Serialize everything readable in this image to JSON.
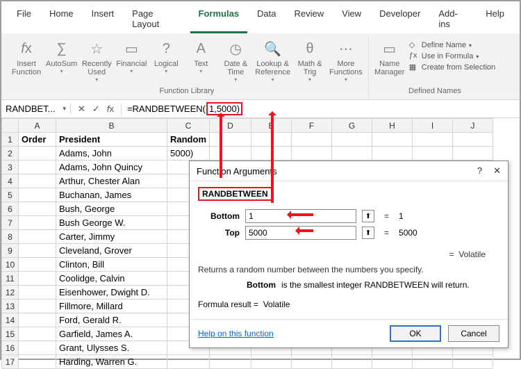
{
  "tabs": [
    "File",
    "Home",
    "Insert",
    "Page Layout",
    "Formulas",
    "Data",
    "Review",
    "View",
    "Developer",
    "Add-ins",
    "Help"
  ],
  "active_tab": "Formulas",
  "ribbon": {
    "group1": {
      "insert_function": "Insert\nFunction",
      "autosum": "AutoSum",
      "recently": "Recently\nUsed",
      "financial": "Financial",
      "logical": "Logical",
      "text": "Text",
      "date": "Date &\nTime",
      "lookup": "Lookup &\nReference",
      "math": "Math &\nTrig",
      "more": "More\nFunctions",
      "label": "Function Library"
    },
    "group2": {
      "name_manager": "Name\nManager",
      "define_name": "Define Name",
      "use_in_formula": "Use in Formula",
      "create_from_selection": "Create from Selection",
      "label": "Defined Names"
    }
  },
  "namebox": "RANDBET...",
  "formula": {
    "prefix": "=RANDBETWEEN(",
    "args": "1,5000)"
  },
  "columns": [
    "A",
    "B",
    "C",
    "D",
    "E",
    "F",
    "G",
    "H",
    "I",
    "J"
  ],
  "headers": {
    "A": "Order",
    "B": "President",
    "C": "Random"
  },
  "rows": [
    {
      "n": 1
    },
    {
      "n": 2,
      "B": "Adams, John",
      "C": "5000)"
    },
    {
      "n": 3,
      "B": "Adams, John Quincy"
    },
    {
      "n": 4,
      "B": "Arthur, Chester Alan"
    },
    {
      "n": 5,
      "B": "Buchanan, James"
    },
    {
      "n": 6,
      "B": "Bush, George"
    },
    {
      "n": 7,
      "B": "Bush George W."
    },
    {
      "n": 8,
      "B": "Carter, Jimmy"
    },
    {
      "n": 9,
      "B": "Cleveland, Grover"
    },
    {
      "n": 10,
      "B": "Clinton, Bill"
    },
    {
      "n": 11,
      "B": "Coolidge, Calvin"
    },
    {
      "n": 12,
      "B": "Eisenhower, Dwight D."
    },
    {
      "n": 13,
      "B": "Fillmore, Millard"
    },
    {
      "n": 14,
      "B": "Ford, Gerald R."
    },
    {
      "n": 15,
      "B": "Garfield, James A."
    },
    {
      "n": 16,
      "B": "Grant, Ulysses S."
    },
    {
      "n": 17,
      "B": "Harding, Warren G."
    }
  ],
  "dialog": {
    "title": "Function Arguments",
    "fn": "RANDBETWEEN",
    "bottom_label": "Bottom",
    "bottom_value": "1",
    "bottom_result": "1",
    "top_label": "Top",
    "top_value": "5000",
    "top_result": "5000",
    "volatile": "Volatile",
    "eq": "=",
    "desc": "Returns a random number between the numbers you specify.",
    "argname": "Bottom",
    "argdesc": "is the smallest integer RANDBETWEEN will return.",
    "result_label": "Formula result =",
    "result_value": "Volatile",
    "help": "Help on this function",
    "ok": "OK",
    "cancel": "Cancel"
  }
}
